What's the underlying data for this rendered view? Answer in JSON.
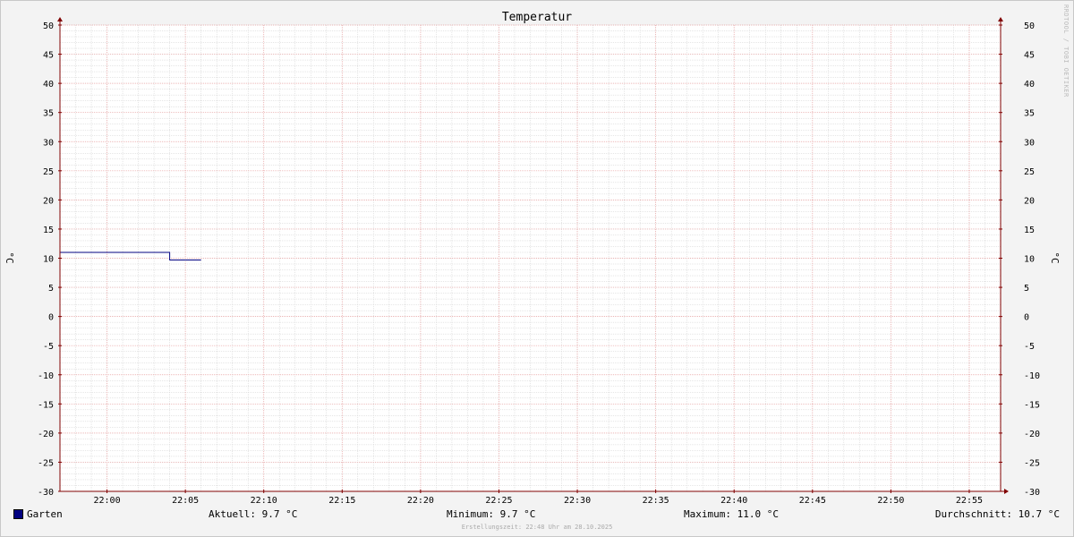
{
  "chart_data": {
    "type": "line",
    "title": "Temperatur",
    "ylabel": "°C",
    "ylabel_right": "°C",
    "ylim": [
      -30,
      50
    ],
    "y_ticks": [
      50,
      45,
      40,
      35,
      30,
      25,
      20,
      15,
      10,
      5,
      0,
      -5,
      -10,
      -15,
      -20,
      -25,
      -30
    ],
    "x_range": [
      "21:57",
      "22:57"
    ],
    "x_ticks": [
      "22:00",
      "22:05",
      "22:10",
      "22:15",
      "22:20",
      "22:25",
      "22:30",
      "22:35",
      "22:40",
      "22:45",
      "22:50",
      "22:55"
    ],
    "grid": true,
    "series": [
      {
        "name": "Garten",
        "color": "#000080",
        "points": [
          {
            "x": "21:57",
            "y": 11.0
          },
          {
            "x": "22:04",
            "y": 11.0
          },
          {
            "x": "22:04",
            "y": 9.7
          },
          {
            "x": "22:06",
            "y": 9.7
          }
        ]
      }
    ]
  },
  "legend": {
    "label": "Garten",
    "color": "#000080"
  },
  "stats": {
    "aktuell": "Aktuell: 9.7 °C",
    "minimum": "Minimum: 9.7 °C",
    "maximum": "Maximum: 11.0 °C",
    "durchschnitt": "Durchschnitt: 10.7 °C"
  },
  "footer": "Erstellungszeit: 22:48 Uhr am 28.10.2025",
  "watermark": "RRDTOOL / TOBI OETIKER",
  "colors": {
    "grid_major": "#e8a0a0",
    "grid_minor": "#cccccc",
    "axis": "#800000",
    "plot_bg": "#ffffff"
  }
}
